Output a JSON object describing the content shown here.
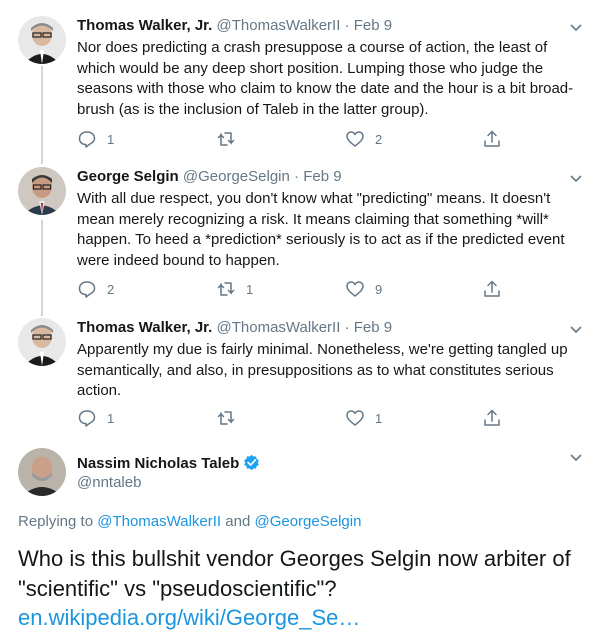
{
  "tweets": [
    {
      "name": "Thomas Walker, Jr.",
      "handle": "@ThomasWalkerII",
      "date": "Feb 9",
      "text": "Nor does predicting a crash presuppose a course of action, the least of which would be any deep short position.  Lumping those who judge the seasons with those who claim to know the date and the hour is a bit broad-brush (as is the inclusion of Taleb in the latter group).",
      "replies": "1",
      "retweets": "",
      "likes": "2"
    },
    {
      "name": "George Selgin",
      "handle": "@GeorgeSelgin",
      "date": "Feb 9",
      "text": "With all due respect, you don't know what \"predicting\" means. It doesn't mean merely recognizing a risk. It means claiming that something *will* happen. To heed a *prediction* seriously is to act as if the predicted event were indeed bound to happen.",
      "replies": "2",
      "retweets": "1",
      "likes": "9"
    },
    {
      "name": "Thomas Walker, Jr.",
      "handle": "@ThomasWalkerII",
      "date": "Feb 9",
      "text": "Apparently my due is fairly minimal.  Nonetheless, we're getting tangled up semantically, and also, in presuppositions as to what constitutes serious action.",
      "replies": "1",
      "retweets": "",
      "likes": "1"
    }
  ],
  "main_tweet": {
    "name": "Nassim Nicholas Taleb",
    "handle": "@nntaleb",
    "replying_prefix": "Replying to ",
    "replying_to_1": "@ThomasWalkerII",
    "replying_and": " and ",
    "replying_to_2": "@GeorgeSelgin",
    "text": "Who is this bullshit vendor Georges Selgin now arbiter of \"scientific\" vs \"pseudoscientific\"?",
    "link": "en.wikipedia.org/wiki/George_Se…"
  },
  "icons": {
    "reply": "reply-icon",
    "retweet": "retweet-icon",
    "like": "heart-icon",
    "share": "share-icon",
    "more": "chevron-down-icon",
    "verified": "verified-badge-icon"
  },
  "colors": {
    "link": "#1b95e0",
    "secondary_text": "#657786",
    "thread_line": "#ccd6dd",
    "verified": "#1da1f2"
  }
}
